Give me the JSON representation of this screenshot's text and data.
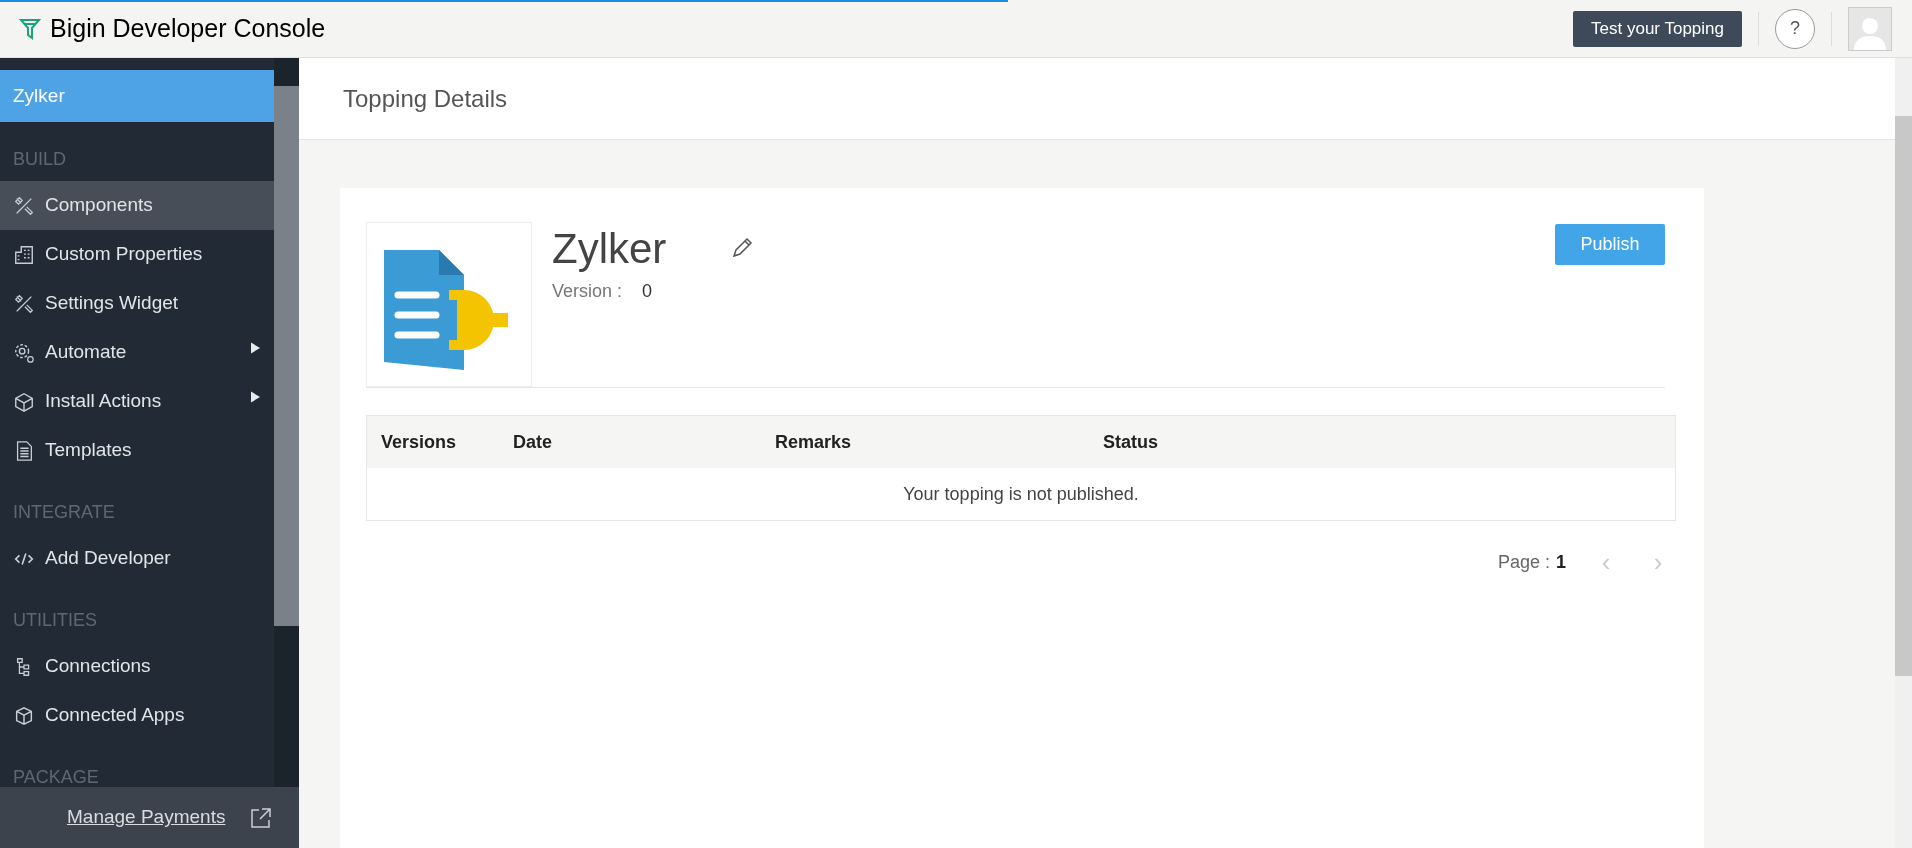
{
  "header": {
    "app_title": "Bigin Developer Console",
    "test_button": "Test your Topping",
    "help_button": "?"
  },
  "sidebar": {
    "project": {
      "label": "Zylker",
      "selected": true
    },
    "entries": [
      {
        "kind": "section",
        "label": "BUILD"
      },
      {
        "kind": "item",
        "label": "Components",
        "selected": true,
        "submenu": false
      },
      {
        "kind": "item",
        "label": "Custom Properties",
        "selected": false,
        "submenu": false
      },
      {
        "kind": "item",
        "label": "Settings Widget",
        "selected": false,
        "submenu": false
      },
      {
        "kind": "item",
        "label": "Automate",
        "selected": false,
        "submenu": true
      },
      {
        "kind": "item",
        "label": "Install Actions",
        "selected": false,
        "submenu": true
      },
      {
        "kind": "item",
        "label": "Templates",
        "selected": false,
        "submenu": false
      },
      {
        "kind": "section",
        "label": "INTEGRATE"
      },
      {
        "kind": "item",
        "label": "Add Developer",
        "selected": false,
        "submenu": false
      },
      {
        "kind": "section",
        "label": "UTILITIES"
      },
      {
        "kind": "item",
        "label": "Connections",
        "selected": false,
        "submenu": false
      },
      {
        "kind": "item",
        "label": "Connected Apps",
        "selected": false,
        "submenu": false
      },
      {
        "kind": "section",
        "label": "PACKAGE"
      }
    ],
    "footer_link": "Manage Payments"
  },
  "page": {
    "title": "Topping Details",
    "topping": {
      "name": "Zylker",
      "version_label": "Version :",
      "version": "0",
      "publish_button": "Publish"
    },
    "table": {
      "columns": [
        "Versions",
        "Date",
        "Remarks",
        "Status"
      ],
      "empty_message": "Your topping is not published."
    },
    "pagination": {
      "label": "Page :",
      "page": "1",
      "prev": "‹",
      "next": "›"
    }
  }
}
